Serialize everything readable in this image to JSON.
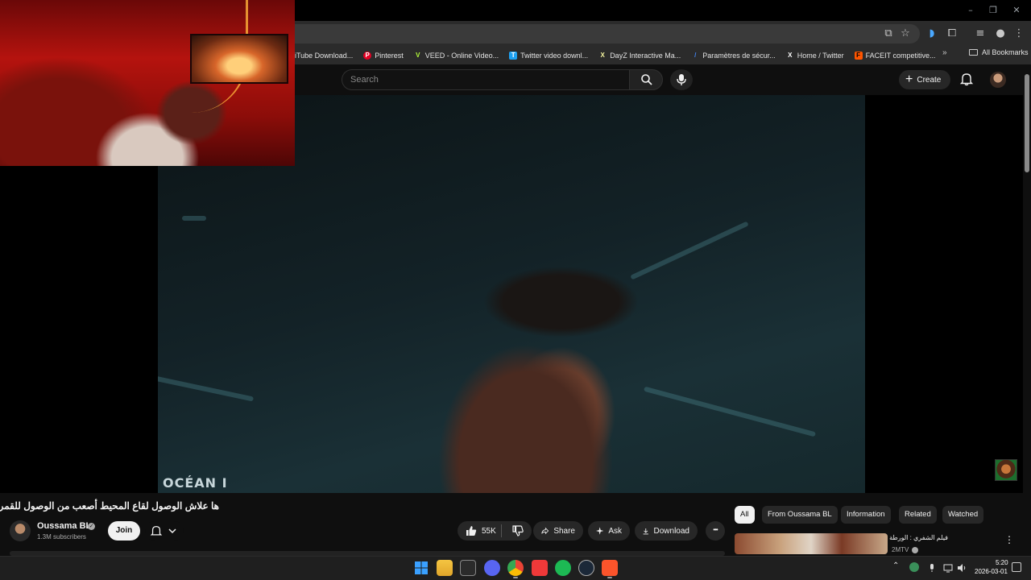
{
  "bookmarks": {
    "items": [
      {
        "label": "iTube Download...",
        "color": "#d33",
        "glyph": ""
      },
      {
        "label": "Pinterest",
        "color": "#e60023",
        "glyph": "P"
      },
      {
        "label": "VEED - Online Video...",
        "color": "#b6ff3b",
        "glyph": "V"
      },
      {
        "label": "Twitter video downl...",
        "color": "#1da1f2",
        "glyph": "T"
      },
      {
        "label": "DayZ Interactive Ma...",
        "color": "#1b1b1b",
        "glyph": "X"
      },
      {
        "label": "Paramètres de sécur...",
        "color": "#4285f4",
        "glyph": "/"
      },
      {
        "label": "Home / Twitter",
        "color": "#000000",
        "glyph": "X"
      },
      {
        "label": "FACEIT competitive...",
        "color": "#ff5500",
        "glyph": "F"
      }
    ],
    "more_label": "»",
    "all_bookmarks_label": "All Bookmarks"
  },
  "youtube_header": {
    "search_placeholder": "Search",
    "create_label": "Create"
  },
  "video": {
    "overlay_text": "OCÉAN I",
    "title": "ها علاش الوصول لقاع المحيط أصعب من الوصول للقمر"
  },
  "channel": {
    "name": "Oussama BL",
    "subscribers": "1.3M subscribers",
    "join_label": "Join"
  },
  "actions": {
    "likes": "55K",
    "share_label": "Share",
    "ask_label": "Ask",
    "download_label": "Download",
    "more_label": "•••"
  },
  "chips": [
    {
      "label": "All",
      "active": true
    },
    {
      "label": "From Oussama BL",
      "active": false
    },
    {
      "label": "Information",
      "active": false
    },
    {
      "label": "Related",
      "active": false
    },
    {
      "label": "Watched",
      "active": false
    }
  ],
  "recommendation": {
    "title": "فيلم الشفري : الورطة",
    "channel": "2MTV"
  },
  "taskbar": {
    "time": "5:20",
    "date": "2026-03-01",
    "apps": [
      "windows-start",
      "file-explorer",
      "microsoft-store",
      "discord",
      "chrome",
      "vivaldi",
      "spotify",
      "steam",
      "brave"
    ]
  },
  "colors": {
    "accent_like": "#f1f1f1",
    "background": "#0f0f0f",
    "chip_bg": "#272727"
  }
}
